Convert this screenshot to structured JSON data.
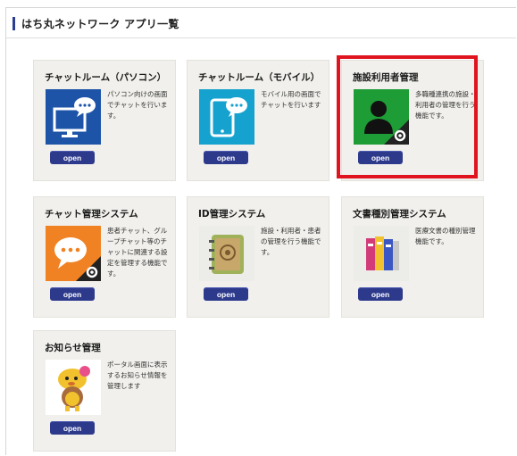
{
  "header": {
    "title": "はち丸ネットワーク アプリ一覧"
  },
  "cards": [
    {
      "title": "チャットルーム（パソコン）",
      "desc": "パソコン向けの画面でチャットを行います。",
      "button": "open",
      "icon": "desktop-chat-icon",
      "color": "#1d54a8"
    },
    {
      "title": "チャットルーム（モバイル）",
      "desc": "モバイル用の画面でチャットを行います",
      "button": "open",
      "icon": "mobile-chat-icon",
      "color": "#16a2cf"
    },
    {
      "title": "施設利用者管理",
      "desc": "多職種連携の施設・利用者の管理を行う機能です。",
      "button": "open",
      "icon": "user-admin-icon",
      "color": "#1e9c35"
    },
    {
      "title": "チャット管理システム",
      "desc": "患者チャット、グループチャット等のチャットに関連する設定を管理する機能です。",
      "button": "open",
      "icon": "chat-settings-icon",
      "color": "#f08224"
    },
    {
      "title": "ID管理システム",
      "desc": "施設・利用者・患者の管理を行う機能です。",
      "button": "open",
      "icon": "address-book-icon",
      "color": "#8fa44a"
    },
    {
      "title": "文書種別管理システム",
      "desc": "医療文書の種別管理機能です。",
      "button": "open",
      "icon": "binders-icon",
      "color": "#d23a7a"
    },
    {
      "title": "お知らせ管理",
      "desc": "ポータル画面に表示するお知らせ情報を管理します",
      "button": "open",
      "icon": "mascot-icon",
      "color": "#f2c12e"
    }
  ],
  "highlight": {
    "color": "#e0141e"
  }
}
